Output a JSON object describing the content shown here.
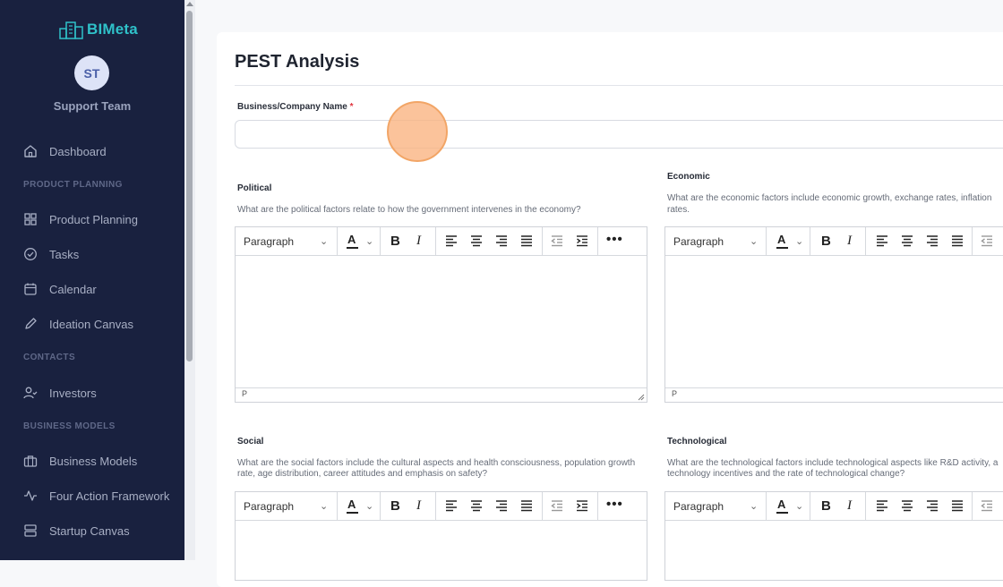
{
  "sidebar": {
    "logo_text": "BIMeta",
    "avatar_initials": "ST",
    "user_name": "Support Team",
    "items": [
      {
        "label": "Dashboard",
        "icon": "home-icon"
      },
      {
        "heading": "PRODUCT PLANNING"
      },
      {
        "label": "Product Planning",
        "icon": "grid-icon"
      },
      {
        "label": "Tasks",
        "icon": "check-circle-icon"
      },
      {
        "label": "Calendar",
        "icon": "calendar-icon"
      },
      {
        "label": "Ideation Canvas",
        "icon": "pencil-icon"
      },
      {
        "heading": "CONTACTS"
      },
      {
        "label": "Investors",
        "icon": "user-check-icon"
      },
      {
        "heading": "BUSINESS MODELS"
      },
      {
        "label": "Business Models",
        "icon": "briefcase-icon"
      },
      {
        "label": "Four Action Framework",
        "icon": "activity-icon"
      },
      {
        "label": "Startup Canvas",
        "icon": "server-icon"
      }
    ]
  },
  "page": {
    "title": "PEST Analysis",
    "company_label": "Business/Company Name",
    "required_mark": "*",
    "company_value": ""
  },
  "sections": {
    "political": {
      "title": "Political",
      "desc": "What are the political factors relate to how the government intervenes in the economy?"
    },
    "economic": {
      "title": "Economic",
      "desc_line1": "What are the economic factors include economic growth, exchange rates, inflation",
      "desc_line2": "rates."
    },
    "social": {
      "title": "Social",
      "desc_line1": "What are the social factors include the cultural aspects and health consciousness, population growth",
      "desc_line2": "rate, age distribution, career attitudes and emphasis on safety?"
    },
    "technological": {
      "title": "Technological",
      "desc_line1": "What are the technological factors include technological aspects like R&D activity, a",
      "desc_line2": "technology incentives and the rate of technological change?"
    }
  },
  "editor": {
    "paragraph_label": "Paragraph",
    "font_color_label": "A",
    "bold_label": "B",
    "italic_label": "I",
    "more_label": "•••",
    "status_path": "P"
  },
  "colors": {
    "sidebar_bg": "#19213f",
    "logo_accent": "#2fc1c9",
    "required": "#e0343e"
  }
}
